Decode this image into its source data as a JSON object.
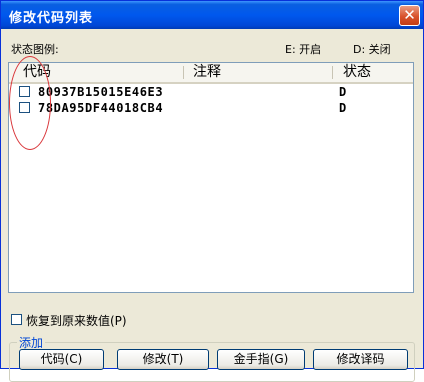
{
  "window": {
    "title": "修改代码列表",
    "close_glyph": "✕"
  },
  "legend": {
    "label": "状态图例:",
    "on": "E: 开启",
    "off": "D: 关闭"
  },
  "list": {
    "columns": [
      "代码",
      "注释",
      "状态"
    ],
    "rows": [
      {
        "code": "80937B15015E46E3",
        "comment": "",
        "status": "D",
        "checked": false
      },
      {
        "code": "78DA95DF44018CB4",
        "comment": "",
        "status": "D",
        "checked": false
      }
    ]
  },
  "restore": {
    "label": "恢复到原来数值(P)",
    "checked": false
  },
  "add_group": {
    "title": "添加",
    "buttons": [
      "代码(C)",
      "修改(T)",
      "金手指(G)",
      "修改译码"
    ]
  },
  "colors": {
    "titlebar": "#0058ee",
    "window_bg": "#ece9d8",
    "annotation": "#d9363a"
  }
}
